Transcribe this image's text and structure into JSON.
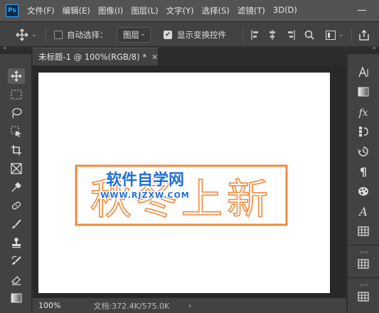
{
  "menu": {
    "logo": "Ps",
    "items": [
      "文件(F)",
      "编辑(E)",
      "图像(I)",
      "图层(L)",
      "文字(Y)",
      "选择(S)",
      "滤镜(T)",
      "3D(D)"
    ]
  },
  "options": {
    "auto_select_label": "自动选择：",
    "auto_select_checked": false,
    "auto_select_value": "图层",
    "show_transform_label": "显示变换控件",
    "show_transform_checked": true
  },
  "document": {
    "tab_title": "未标题-1 @ 100%(RGB/8) *",
    "canvas_text": "秋冬上新",
    "watermark_title": "软件自学网",
    "watermark_url": "WWW.RJZXW.COM"
  },
  "status": {
    "zoom": "100%",
    "doc_size": "文档:372.4K/575.0K"
  },
  "colors": {
    "accent_orange": "#f08a3c",
    "watermark_blue": "#1e6fd9",
    "ps_blue": "#31a8ff"
  },
  "left_tools": [
    "move-tool-icon",
    "marquee-tool-icon",
    "lasso-tool-icon",
    "object-select-tool-icon",
    "crop-tool-icon",
    "frame-tool-icon",
    "eyedropper-tool-icon",
    "healing-tool-icon",
    "brush-tool-icon",
    "stamp-tool-icon",
    "history-brush-icon",
    "eraser-tool-icon",
    "gradient-tool-icon"
  ],
  "right_panels": [
    "character-icon",
    "gradient-panel-icon",
    "styles-fx-icon",
    "channels-icon",
    "history-icon",
    "paragraph-icon",
    "swatches-icon",
    "glyphs-icon",
    "table-icon",
    "libraries-icon",
    "properties-icon"
  ]
}
